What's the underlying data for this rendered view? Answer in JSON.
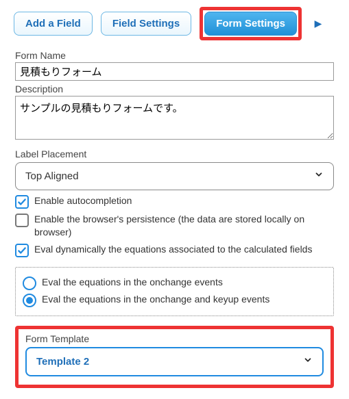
{
  "tabs": {
    "add_field": "Add a Field",
    "field_settings": "Field Settings",
    "form_settings": "Form Settings"
  },
  "form": {
    "name_label": "Form Name",
    "name_value": "見積もりフォーム",
    "description_label": "Description",
    "description_value": "サンプルの見積もりフォームです。",
    "label_placement_label": "Label Placement",
    "label_placement_value": "Top Aligned",
    "autocomplete_label": "Enable autocompletion",
    "persistence_label": "Enable the browser's persistence (the data are stored locally on browser)",
    "eval_dynamic_label": "Eval dynamically the equations associated to the calculated fields",
    "eval_onchange_label": "Eval the equations in the onchange events",
    "eval_onchange_keyup_label": "Eval the equations in the onchange and keyup events",
    "template_label": "Form Template",
    "template_value": "Template 2"
  },
  "state": {
    "autocomplete_checked": true,
    "persistence_checked": false,
    "eval_dynamic_checked": true,
    "eval_radio_selected": "keyup"
  }
}
